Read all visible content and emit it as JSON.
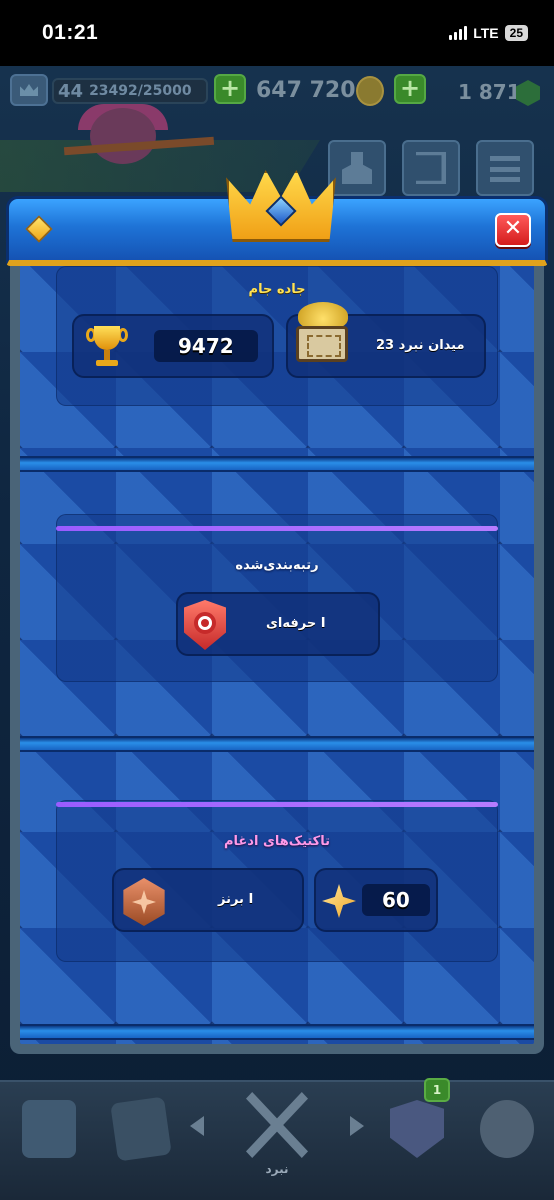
{
  "status_bar": {
    "time": "01:21",
    "network": "LTE",
    "battery": "25"
  },
  "topbar": {
    "level": "44",
    "xp": "23492/25000",
    "gold": "647 720",
    "gems": "1 871"
  },
  "modal": {
    "trophy_road": {
      "title": "جاده جام",
      "trophies": "9472",
      "arena_label": "میدان نبرد 23"
    },
    "ranked": {
      "title": "رتبه‌بندی‌شده",
      "league_label": "حرفه‌ای I"
    },
    "merge_tactics": {
      "title": "تاکتیک‌های ادغام",
      "rank_label": "برنز I",
      "points": "60"
    }
  },
  "bottom_nav": {
    "active_label": "نبرد",
    "clan_badge": "1"
  },
  "colors": {
    "accent_gold": "#ffe255",
    "modal_blue": "#1e50a8",
    "purple_line": "#9a5cff",
    "close_red": "#d41c1c"
  }
}
